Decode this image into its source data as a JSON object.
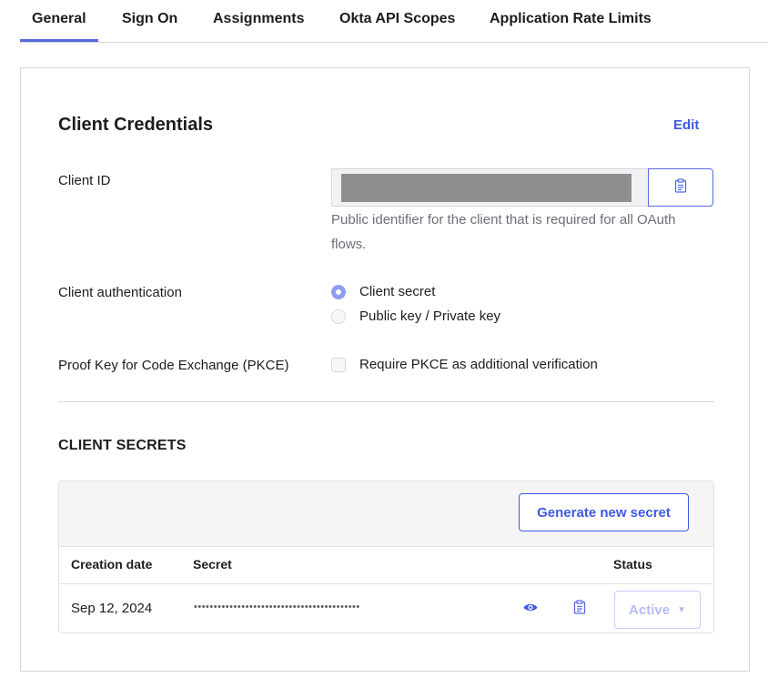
{
  "tabs": [
    {
      "label": "General",
      "active": true
    },
    {
      "label": "Sign On"
    },
    {
      "label": "Assignments"
    },
    {
      "label": "Okta API Scopes"
    },
    {
      "label": "Application Rate Limits"
    }
  ],
  "credentials": {
    "title": "Client Credentials",
    "edit_label": "Edit",
    "client_id_label": "Client ID",
    "client_id_help": "Public identifier for the client that is required for all OAuth flows.",
    "auth_label": "Client authentication",
    "auth_options": [
      {
        "label": "Client secret",
        "selected": true
      },
      {
        "label": "Public key / Private key",
        "selected": false
      }
    ],
    "pkce_label": "Proof Key for Code Exchange (PKCE)",
    "pkce_option": "Require PKCE as additional verification",
    "pkce_checked": false
  },
  "secrets": {
    "section_title": "CLIENT SECRETS",
    "generate_label": "Generate new secret",
    "columns": [
      "Creation date",
      "Secret",
      "Status"
    ],
    "rows": [
      {
        "date": "Sep 12, 2024",
        "secret_masked": "••••••••••••••••••••••••••••••••••••••••••",
        "status": "Active"
      }
    ]
  },
  "icons": {
    "copy": "clipboard-icon",
    "reveal": "eye-icon",
    "caret": "caret-down-icon"
  },
  "colors": {
    "accent": "#3f59e4",
    "tab_indicator": "#546be7",
    "radio_selected": "#8e9df0",
    "status_disabled": "#b3bdf2"
  }
}
